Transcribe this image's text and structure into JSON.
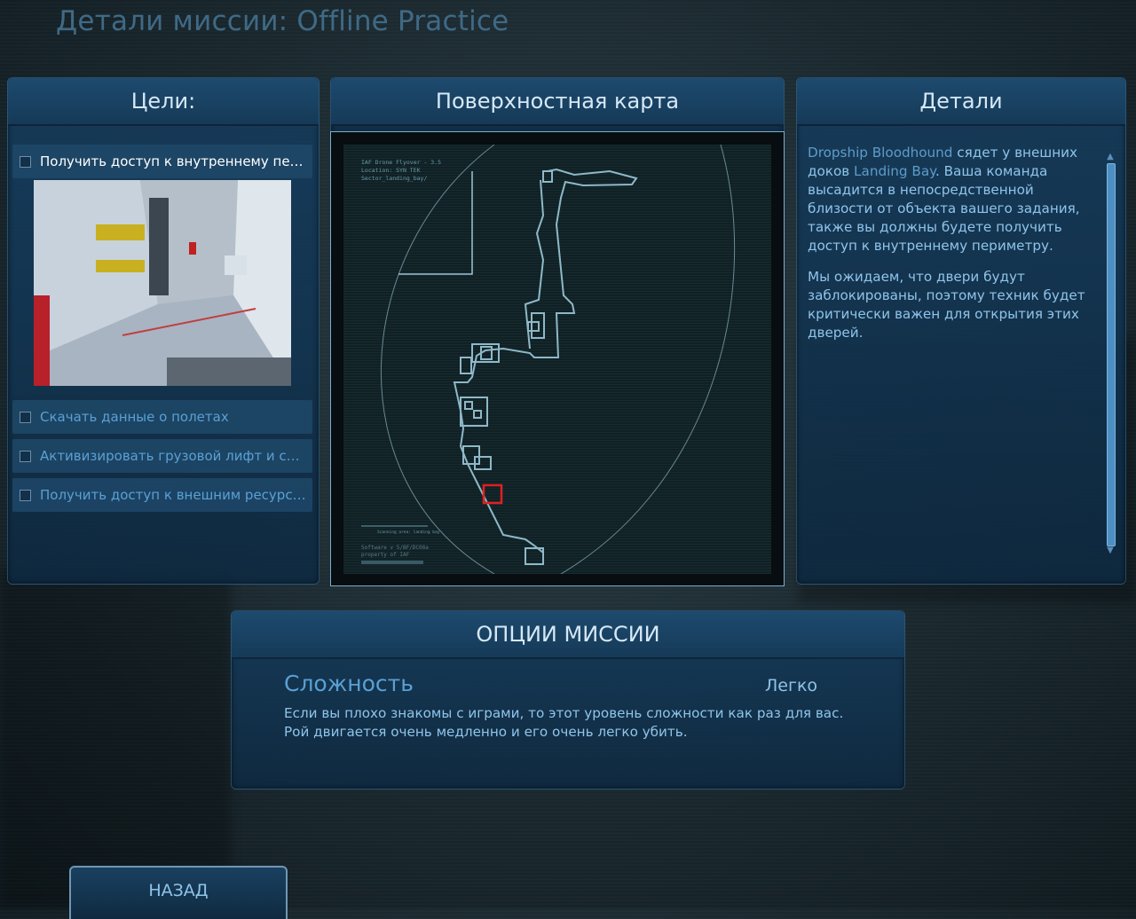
{
  "title": "Детали миссии: Offline Practice",
  "objectives": {
    "header": "Цели:",
    "items": [
      {
        "label": "Получить доступ к внутреннему периметру",
        "active": true
      },
      {
        "label": "Скачать данные о полетах",
        "active": false
      },
      {
        "label": "Активизировать грузовой лифт и спуститься",
        "active": false
      },
      {
        "label": "Получить доступ к внешним ресурсам",
        "active": false
      }
    ]
  },
  "map": {
    "header": "Поверхностная карта",
    "overlay_lines": [
      "IAF Drone Flyover - 3.5",
      "Location: SYN TEK",
      "Sector_landing_bay/"
    ],
    "footer_lines": [
      "Software v 5/BF/DC08a",
      "property of IAF"
    ],
    "scan_label": "Scanning area: landing bay"
  },
  "details": {
    "header": "Детали",
    "p1_a": "Dropship Bloodhound",
    "p1_b": " сядет у внешних доков ",
    "p1_c": "Landing Bay",
    "p1_d": ". Ваша команда высадится в непосредственной близости от объекта вашего задания, также вы должны будете получить доступ к внутреннему периметру.",
    "p2": "Мы ожидаем, что двери будут заблокированы, поэтому техник будет критически важен для открытия этих дверей."
  },
  "options": {
    "header": "ОПЦИИ МИССИИ",
    "difficulty_label": "Сложность",
    "difficulty_value": "Легко",
    "difficulty_desc_1": "Если вы плохо знакомы с играми, то этот уровень сложности как раз для вас.",
    "difficulty_desc_2": "Рой двигается очень медленно и его очень легко убить."
  },
  "back_button": "НАЗАД",
  "colors": {
    "accent": "#5aa0d4",
    "header_text": "#d6e8f6",
    "marker": "#e02020"
  }
}
